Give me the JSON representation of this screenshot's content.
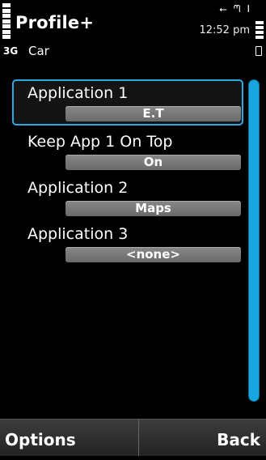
{
  "status": {
    "app_title": "Profile+",
    "clock": "12:52 pm",
    "network": "3G",
    "profile": "Car",
    "icons": [
      "usb-icon",
      "headset-icon",
      "bluetooth-icon"
    ]
  },
  "list": {
    "items": [
      {
        "label": "Application 1",
        "value": "E.T",
        "selected": true
      },
      {
        "label": "Keep App 1 On Top",
        "value": "On",
        "selected": false
      },
      {
        "label": "Application 2",
        "value": "Maps",
        "selected": false
      },
      {
        "label": "Application 3",
        "value": "<none>",
        "selected": false
      }
    ]
  },
  "softkeys": {
    "left": "Options",
    "right": "Back"
  },
  "colors": {
    "accent": "#17a6df",
    "background": "#000000",
    "value_bg": "#7a7a7a"
  }
}
